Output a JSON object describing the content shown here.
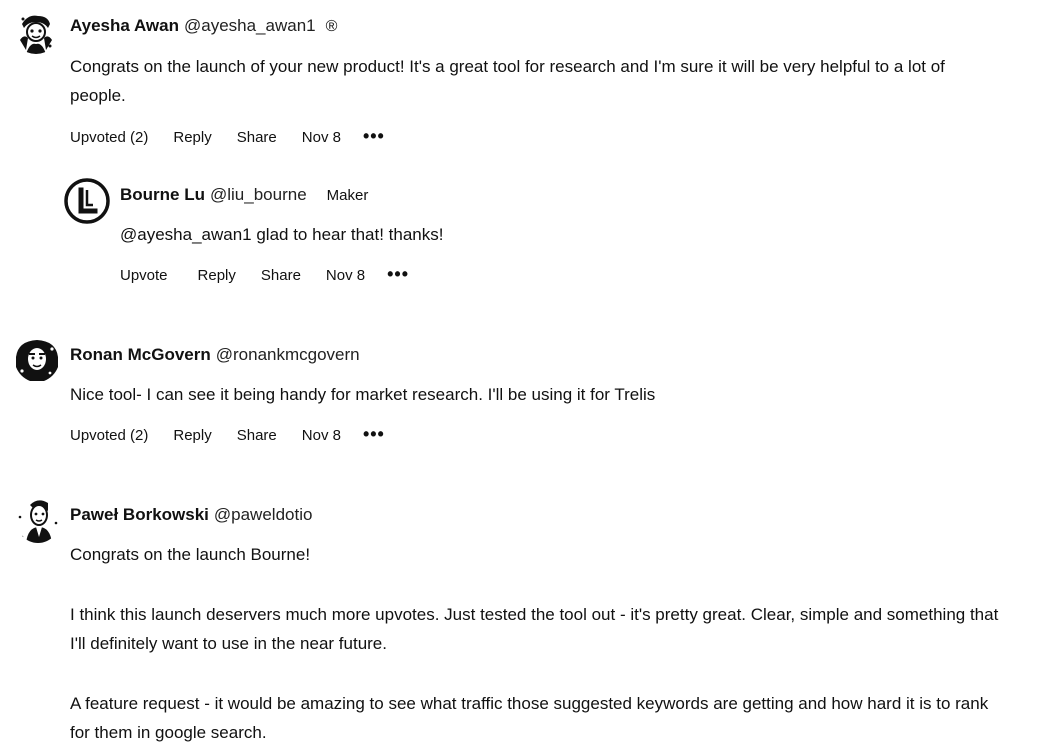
{
  "comments": [
    {
      "author": "Ayesha Awan",
      "handle": "@ayesha_awan1",
      "badge": "®",
      "body": [
        "Congrats on the launch of your new product! It's a great tool for research and I'm sure it will be very helpful to a lot of people."
      ],
      "actions": {
        "vote": "Upvoted (2)",
        "reply": "Reply",
        "share": "Share",
        "date": "Nov 8",
        "more": "•••"
      },
      "avatar_icon": "user-avatar-icon"
    },
    {
      "author": "Bourne Lu",
      "handle": "@liu_bourne",
      "role": "Maker",
      "body": [
        "@ayesha_awan1 glad to hear that! thanks!"
      ],
      "actions": {
        "vote": "Upvote",
        "reply": "Reply",
        "share": "Share",
        "date": "Nov 8",
        "more": "•••"
      },
      "avatar_icon": "letter-l-avatar-icon"
    },
    {
      "author": "Ronan McGovern",
      "handle": "@ronankmcgovern",
      "body": [
        "Nice tool- I can see it being handy for market research. I'll be using it for Trelis"
      ],
      "actions": {
        "vote": "Upvoted (2)",
        "reply": "Reply",
        "share": "Share",
        "date": "Nov 8",
        "more": "•••"
      },
      "avatar_icon": "user-avatar-icon"
    },
    {
      "author": "Paweł Borkowski",
      "handle": "@paweldotio",
      "body": [
        "Congrats on the launch Bourne!",
        "I think this launch deservers much more upvotes. Just tested the tool out - it's pretty great. Clear, simple and something that I'll definitely want to use in the near future.",
        "A feature request - it would be amazing to see what traffic those suggested keywords are getting and how hard it is to rank for them in google search."
      ],
      "avatar_icon": "user-avatar-icon"
    }
  ]
}
